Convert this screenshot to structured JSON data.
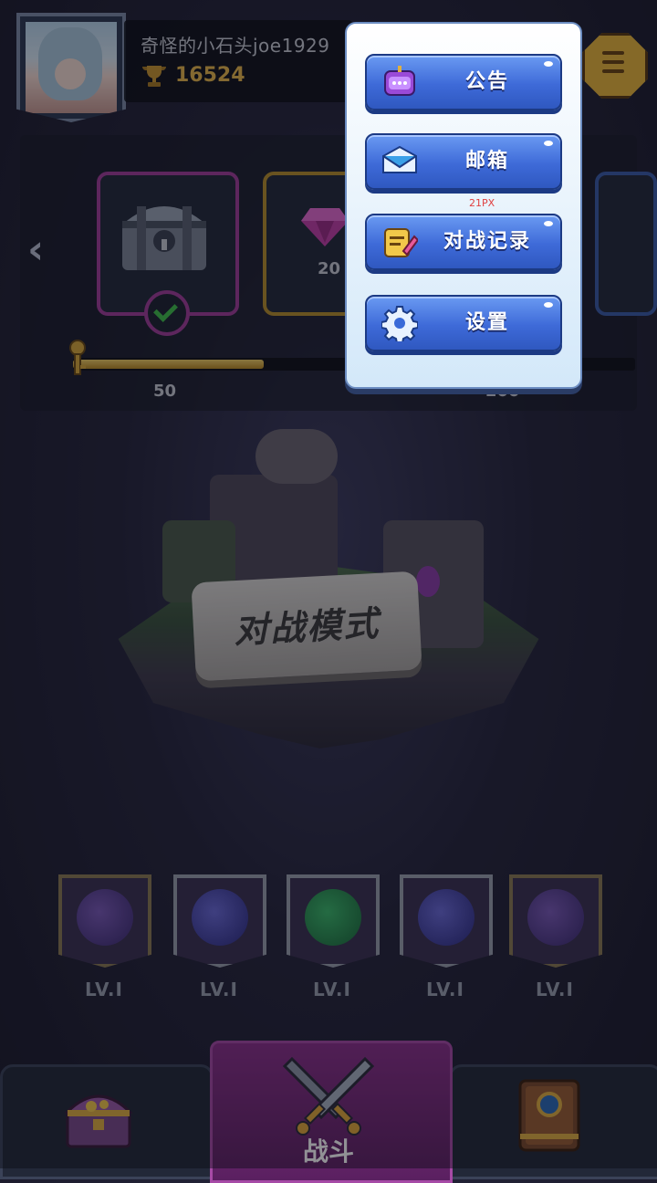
{
  "player": {
    "name": "奇怪的小石头joe1929",
    "trophies": "16524"
  },
  "rewards": {
    "gem_count": "20",
    "progress_fraction": 0.34,
    "ticks": [
      "50",
      "200"
    ]
  },
  "mode": {
    "title": "对战模式"
  },
  "heroes": [
    {
      "level": "LV.I",
      "frame": "gold"
    },
    {
      "level": "LV.I",
      "frame": "silver"
    },
    {
      "level": "LV.I",
      "frame": "silver"
    },
    {
      "level": "LV.I",
      "frame": "silver"
    },
    {
      "level": "LV.I",
      "frame": "gold"
    }
  ],
  "nav": {
    "center_label": "战斗"
  },
  "menu": {
    "items": [
      {
        "label": "公告",
        "icon": "announcement-icon"
      },
      {
        "label": "邮箱",
        "icon": "mail-icon"
      },
      {
        "label": "对战记录",
        "icon": "battle-record-icon"
      },
      {
        "label": "设置",
        "icon": "gear-icon"
      }
    ],
    "spacing_note": "21PX"
  },
  "colors": {
    "menu_button_blue": "#3e6ad8",
    "accent_gold": "#e8b74a",
    "accent_purple": "#8a2f8a"
  }
}
